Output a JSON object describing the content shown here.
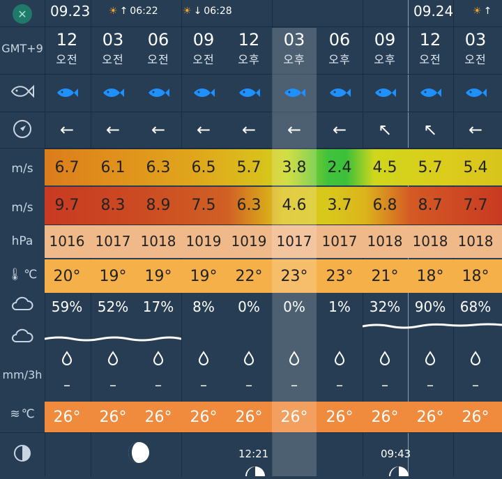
{
  "top": {
    "date1": "09.23",
    "sunrise": "06:22",
    "sunset": "06:28",
    "date2": "09.24"
  },
  "labels": {
    "timezone": "GMT+9",
    "wind_unit": "m/s",
    "gust_unit": "m/s",
    "pressure_unit": "hPa",
    "temp_unit": "℃",
    "water_temp_unit": "℃",
    "precip_unit": "mm/3h"
  },
  "columns": [
    {
      "hour": "12",
      "ampm": "오전",
      "arrow": "←",
      "wind": "6.7",
      "gust": "9.7",
      "pressure": "1016",
      "temp": "20°",
      "cloud": "59%",
      "water": "26°"
    },
    {
      "hour": "03",
      "ampm": "오전",
      "arrow": "←",
      "wind": "6.1",
      "gust": "8.3",
      "pressure": "1017",
      "temp": "19°",
      "cloud": "52%",
      "water": "26°"
    },
    {
      "hour": "06",
      "ampm": "오전",
      "arrow": "←",
      "wind": "6.3",
      "gust": "8.9",
      "pressure": "1018",
      "temp": "19°",
      "cloud": "17%",
      "water": "26°"
    },
    {
      "hour": "09",
      "ampm": "오전",
      "arrow": "←",
      "wind": "6.5",
      "gust": "7.5",
      "pressure": "1019",
      "temp": "19°",
      "cloud": "8%",
      "water": "26°"
    },
    {
      "hour": "12",
      "ampm": "오후",
      "arrow": "←",
      "wind": "5.7",
      "gust": "6.3",
      "pressure": "1019",
      "temp": "22°",
      "cloud": "0%",
      "water": "26°"
    },
    {
      "hour": "03",
      "ampm": "오후",
      "arrow": "←",
      "wind": "3.8",
      "gust": "4.6",
      "pressure": "1017",
      "temp": "23°",
      "cloud": "0%",
      "water": "26°"
    },
    {
      "hour": "06",
      "ampm": "오후",
      "arrow": "←",
      "wind": "2.4",
      "gust": "3.7",
      "pressure": "1017",
      "temp": "23°",
      "cloud": "1%",
      "water": "26°"
    },
    {
      "hour": "09",
      "ampm": "오후",
      "arrow": "↖",
      "wind": "4.5",
      "gust": "6.8",
      "pressure": "1018",
      "temp": "21°",
      "cloud": "32%",
      "water": "26°"
    },
    {
      "hour": "12",
      "ampm": "오전",
      "arrow": "↖",
      "wind": "5.7",
      "gust": "8.7",
      "pressure": "1018",
      "temp": "18°",
      "cloud": "90%",
      "water": "26°"
    },
    {
      "hour": "03",
      "ampm": "오전",
      "arrow": "←",
      "wind": "5.4",
      "gust": "7.7",
      "pressure": "1018",
      "temp": "18°",
      "cloud": "68%",
      "water": "26°"
    }
  ],
  "precip_dash": "–",
  "moon": {
    "time1": "12:21",
    "time2": "09:43"
  },
  "colors": {
    "background": "#263d54",
    "fish": "#1e90ff",
    "pressure_band": "#f0b98a",
    "temp_band": "#f5b04a",
    "water_band": "#f08a3c"
  }
}
